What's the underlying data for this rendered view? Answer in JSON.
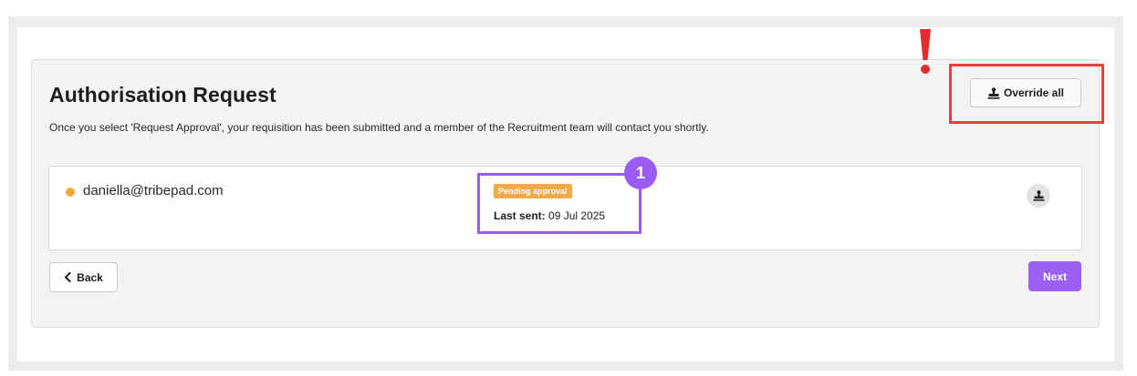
{
  "header": {
    "title": "Authorisation Request",
    "description": "Once you select 'Request Approval', your requisition has been submitted and a member of the Recruitment team will contact you shortly."
  },
  "toolbar": {
    "override_all_label": "Override all",
    "override_icon": "stamp-icon"
  },
  "approvers": [
    {
      "email": "daniella@tribepad.com",
      "status": "Pending approval",
      "status_color": "#f2a947",
      "last_sent_label": "Last sent:",
      "last_sent_value": "09 Jul 2025",
      "action_icon": "stamp-icon"
    }
  ],
  "annotations": {
    "step_number": "1",
    "step_color": "#9b5cf6",
    "highlight_color": "#e93f3f",
    "alert_icon": "exclamation-icon"
  },
  "navigation": {
    "back_label": "Back",
    "back_icon": "chevron-left-icon",
    "next_label": "Next",
    "accent_color": "#9b61f2"
  }
}
